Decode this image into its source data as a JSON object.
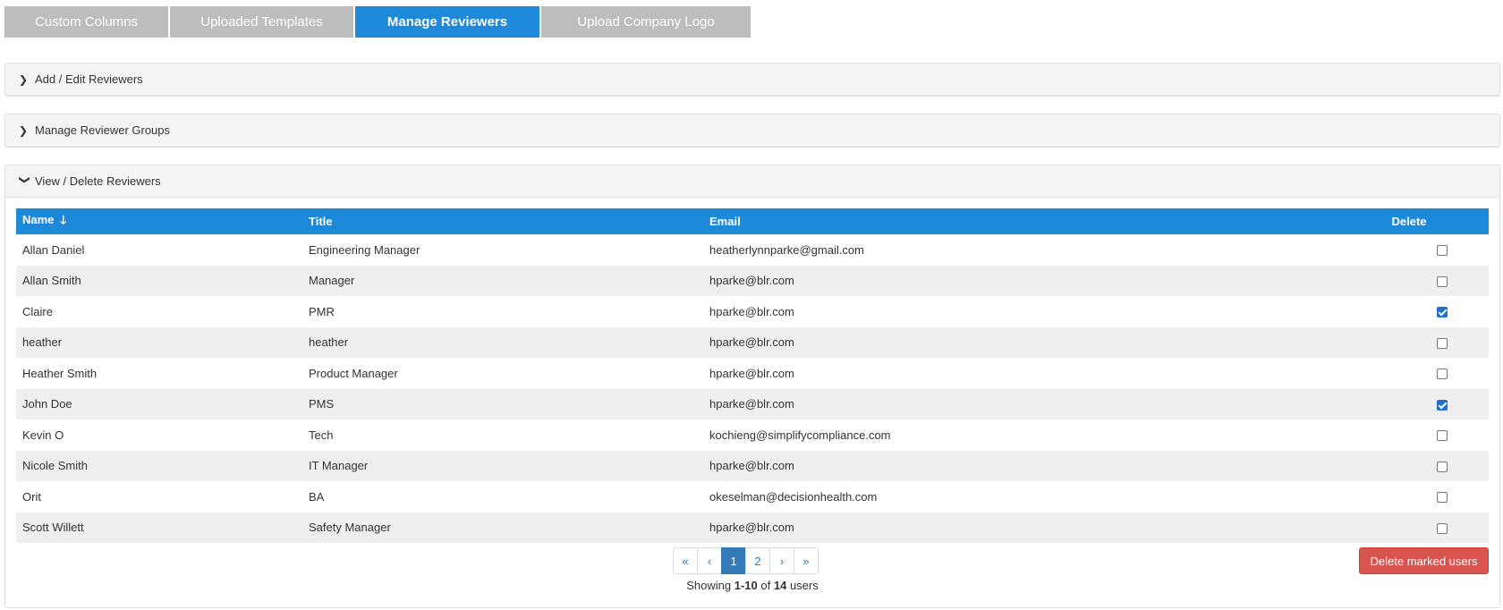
{
  "tabs": [
    {
      "label": "Custom Columns",
      "active": false
    },
    {
      "label": "Uploaded Templates",
      "active": false
    },
    {
      "label": "Manage Reviewers",
      "active": true
    },
    {
      "label": "Upload Company Logo",
      "active": false
    }
  ],
  "panels": {
    "add_edit": {
      "title": "Add / Edit Reviewers",
      "expanded": false
    },
    "groups": {
      "title": "Manage Reviewer Groups",
      "expanded": false
    },
    "view_delete": {
      "title": "View / Delete Reviewers",
      "expanded": true
    }
  },
  "table": {
    "headers": {
      "name": "Name",
      "title": "Title",
      "email": "Email",
      "delete": "Delete"
    },
    "sort_icon": "arrow-down-icon",
    "rows": [
      {
        "name": "Allan Daniel",
        "title": "Engineering Manager",
        "email": "heatherlynnparke@gmail.com",
        "checked": false
      },
      {
        "name": "Allan Smith",
        "title": "Manager",
        "email": "hparke@blr.com",
        "checked": false
      },
      {
        "name": "Claire",
        "title": "PMR",
        "email": "hparke@blr.com",
        "checked": true
      },
      {
        "name": "heather",
        "title": "heather",
        "email": "hparke@blr.com",
        "checked": false
      },
      {
        "name": "Heather Smith",
        "title": "Product Manager",
        "email": "hparke@blr.com",
        "checked": false
      },
      {
        "name": "John Doe",
        "title": "PMS",
        "email": "hparke@blr.com",
        "checked": true
      },
      {
        "name": "Kevin O",
        "title": "Tech",
        "email": "kochieng@simplifycompliance.com",
        "checked": false
      },
      {
        "name": "Nicole Smith",
        "title": "IT Manager",
        "email": "hparke@blr.com",
        "checked": false
      },
      {
        "name": "Orit",
        "title": "BA",
        "email": "okeselman@decisionhealth.com",
        "checked": false
      },
      {
        "name": "Scott Willett",
        "title": "Safety Manager",
        "email": "hparke@blr.com",
        "checked": false
      }
    ]
  },
  "pagination": {
    "first": "«",
    "prev": "‹",
    "pages": [
      "1",
      "2"
    ],
    "current": "1",
    "next": "›",
    "last": "»"
  },
  "summary": {
    "prefix": "Showing ",
    "range": "1-10",
    "middle": " of ",
    "total": "14",
    "suffix": " users"
  },
  "actions": {
    "delete_label": "Delete marked users"
  },
  "colors": {
    "accent": "#1e88d9",
    "tab_inactive": "#bdbdbd",
    "danger": "#d9534f",
    "page_active": "#337ab7"
  }
}
